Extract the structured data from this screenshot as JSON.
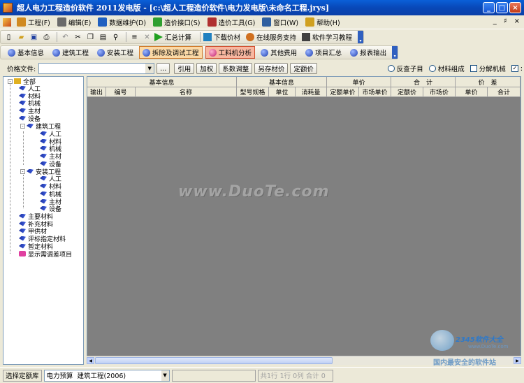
{
  "window": {
    "title": "超人电力工程造价软件 2011发电版 - [c:\\超人工程造价软件\\电力发电版\\未命名工程.jrys]",
    "buttons": {
      "minimize": "_",
      "maximize": "□",
      "close": "×"
    }
  },
  "menubar": {
    "items": [
      {
        "label": "工程(F)",
        "icon": "project-icon",
        "color": "#D08A20"
      },
      {
        "label": "编辑(E)",
        "icon": "edit-icon",
        "color": "#6A6A6A"
      },
      {
        "label": "数据维护(D)",
        "icon": "database-icon",
        "color": "#2060C0"
      },
      {
        "label": "造价接口(S)",
        "icon": "interface-icon",
        "color": "#30A030"
      },
      {
        "label": "造价工具(G)",
        "icon": "tools-icon",
        "color": "#B03030"
      },
      {
        "label": "窗口(W)",
        "icon": "window-icon",
        "color": "#3060A0"
      },
      {
        "label": "帮助(H)",
        "icon": "help-icon",
        "color": "#D0A020"
      }
    ],
    "mdi": [
      "_",
      "♯",
      "×"
    ]
  },
  "toolbar": {
    "icons": [
      "new-file-icon",
      "open-folder-icon",
      "save-icon",
      "print-preview-icon",
      "undo-icon",
      "cut-icon",
      "copy-icon",
      "paste-icon",
      "find-icon",
      "insert-row-icon",
      "delete-icon"
    ],
    "buttons": [
      {
        "label": "汇总计算",
        "icon": "run-icon",
        "color": "#20A020"
      },
      {
        "label": "下载价材",
        "icon": "download-icon",
        "color": "#2080C0"
      },
      {
        "label": "在线服务支持",
        "icon": "support-icon",
        "color": "#D07020"
      },
      {
        "label": "软件学习教程",
        "icon": "tutorial-icon",
        "color": "#404040"
      }
    ]
  },
  "tabs": [
    {
      "label": "基本信息",
      "state": "normal"
    },
    {
      "label": "建筑工程",
      "state": "normal"
    },
    {
      "label": "安装工程",
      "state": "normal"
    },
    {
      "label": "拆除及调试工程",
      "state": "selected"
    },
    {
      "label": "工料机分析",
      "state": "highlight"
    },
    {
      "label": "其他费用",
      "state": "normal"
    },
    {
      "label": "项目汇总",
      "state": "normal"
    },
    {
      "label": "报表输出",
      "state": "normal"
    }
  ],
  "pricebar": {
    "label": "价格文件:",
    "value": "",
    "browse": "...",
    "buttons": [
      "引用",
      "加权",
      "系数调整",
      "另存材价",
      "定额价"
    ],
    "options": [
      {
        "type": "radio",
        "label": "反查子目",
        "checked": false
      },
      {
        "type": "radio",
        "label": "材料组成",
        "checked": false
      },
      {
        "type": "checkbox",
        "label": "分解机械",
        "checked": false
      },
      {
        "type": "checkbox",
        "label": "",
        "checked": true
      }
    ]
  },
  "tree": {
    "root": "全部",
    "items": [
      {
        "label": "人工",
        "level": 1
      },
      {
        "label": "材料",
        "level": 1
      },
      {
        "label": "机械",
        "level": 1
      },
      {
        "label": "主材",
        "level": 1
      },
      {
        "label": "设备",
        "level": 1
      },
      {
        "label": "建筑工程",
        "level": 1,
        "expandable": true
      },
      {
        "label": "人工",
        "level": 2
      },
      {
        "label": "材料",
        "level": 2
      },
      {
        "label": "机械",
        "level": 2
      },
      {
        "label": "主材",
        "level": 2
      },
      {
        "label": "设备",
        "level": 2
      },
      {
        "label": "安装工程",
        "level": 1,
        "expandable": true
      },
      {
        "label": "人工",
        "level": 2
      },
      {
        "label": "材料",
        "level": 2
      },
      {
        "label": "机械",
        "level": 2
      },
      {
        "label": "主材",
        "level": 2
      },
      {
        "label": "设备",
        "level": 2
      },
      {
        "label": "主要材料",
        "level": 1
      },
      {
        "label": "补充材料",
        "level": 1
      },
      {
        "label": "甲供材",
        "level": 1
      },
      {
        "label": "评标指定材料",
        "level": 1
      },
      {
        "label": "暂定材料",
        "level": 1
      }
    ],
    "extra": "显示需调差项目"
  },
  "grid": {
    "group_headers": [
      "基本信息",
      "基本信息",
      "单价",
      "合　计",
      "价　差"
    ],
    "columns": [
      "输出",
      "编号",
      "名称",
      "型号规格",
      "单位",
      "消耗量",
      "定额单价",
      "市场单价",
      "定额价",
      "市场价",
      "单价",
      "合计"
    ]
  },
  "watermark": "www.DuoTe.com",
  "statusbar": {
    "select_label": "选择定额库",
    "budget": "电力预算",
    "library": "建筑工程(2006)",
    "position": "共1行 1行 0列 合计 0"
  },
  "logo": {
    "brand": "2345软件大全",
    "url": "www.DuoTe.com",
    "slogan": "国内最安全的软件站"
  }
}
